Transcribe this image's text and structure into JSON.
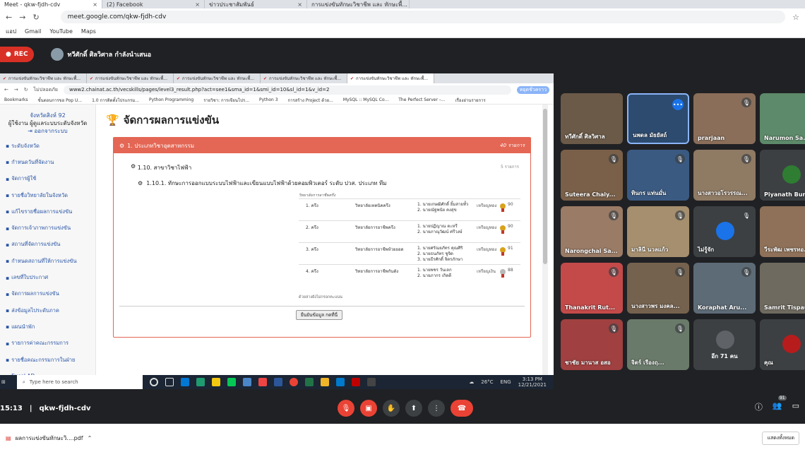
{
  "browser": {
    "tabs": [
      {
        "label": "Meet - qkw-fjdh-cdv",
        "active": true
      },
      {
        "label": "(2) Facebook",
        "active": false
      },
      {
        "label": "ข่าวประชาสัมพันธ์",
        "active": false
      },
      {
        "label": "การแข่งขันทักษะวิชาชีพ และ ทักษะพื้...",
        "active": false
      }
    ],
    "url": "meet.google.com/qkw-fjdh-cdv",
    "bookmarks": [
      "แอป",
      "Gmail",
      "YouTube",
      "Maps"
    ]
  },
  "meet": {
    "rec_label": "REC",
    "presenter": "ทวีศักดิ์ ศิลวิศาล กำลังนำเสนอ",
    "meeting_time": "15:13",
    "meeting_code": "qkw-fjdh-cdv",
    "participant_count": "91"
  },
  "shared": {
    "tabs": [
      "การแข่งขันทักษะวิชาชีพ และ ทักษะพื้...",
      "การแข่งขันทักษะวิชาชีพ และ ทักษะพื้...",
      "การแข่งขันทักษะวิชาชีพ และ ทักษะพื้...",
      "การแข่งขันทักษะวิชาชีพ และ ทักษะพื้...",
      "การแข่งขันทักษะวิชาชีพ และ ทักษะพื้..."
    ],
    "secure_label": "ไม่ปลอดภัย",
    "url": "www2.chainat.ac.th/vecskills/pages/level3_result.php?act=see1&sma_id=1&smi_id=10&sl_id=1&v_id=2",
    "profile": "หยุดชั่วคราว",
    "bookmarks": [
      "Bookmarks",
      "ขั้นตอนการขอ Pop U...",
      "1.0 การติดตั้งโปรแกรม...",
      "Python Programming",
      "รายวิชา: การเขียนโปร...",
      "Python 3",
      "การสร้าง Project ด้วย...",
      "MySQL :: MySQL Co...",
      "The Perfect Server –...",
      "เรื่องอ่านรายการ"
    ],
    "sidebar": {
      "province": "จังหวัดสิงห์ 92",
      "role": "ผู้ใช้งาน ผู้ดูแลระบบระดับจังหวัด",
      "logout": "ออกจากระบบ",
      "items": [
        "ระดับจังหวัด",
        "กำหนดวันที่จัดงาน",
        "จัดการผู้ใช้",
        "รายชื่อวิทยาลัยในจังหวัด",
        "แก้ไขรายชื่อผลการแข่งขัน",
        "จัดการเจ้าภาพการแข่งขัน",
        "สถานที่จัดการแข่งขัน",
        "กำหนดสถานที่ให้การแข่งขัน",
        "เลขที่ใบประกาศ",
        "จัดการผลการแข่งขัน",
        "ส่งข้อมูลไประดับภาค",
        "แผนนำพัก",
        "รายการค่าคณะกรรมการ",
        "รายชื่อคณะกรรมการในฝ่าย",
        "Excel AD"
      ]
    },
    "page_title": "จัดการผลการแข่งขัน",
    "category": {
      "title": "1. ประเภทวิชาอุตสาหกรรม",
      "count": "40 รายการ"
    },
    "subcategory": {
      "title": "1.10. สาขาวิชาไฟฟ้า",
      "count": "5 รายการ"
    },
    "contest": "1.10.1. ทักษะการออกแบบระบบไฟฟ้าและเขียนแบบไฟฟ้าด้วยคอมพิวเตอร์ ระดับ ปวส. ประเภท ทีม",
    "table_caption": "วิทยาลัยการอาชีพครึง",
    "results": [
      {
        "rank": "1. ครึง",
        "college": "วิทยาลัยเทคนิคครึง",
        "members": [
          "1. นายเกษฒิศักดิ์ ยิ้มสายทั้ว",
          "2. นายณัฐพนัย คงสุข"
        ],
        "medal": "เหรียญทอง",
        "medal_type": "gold",
        "score": "90"
      },
      {
        "rank": "2. ครึง",
        "college": "วิทยาลัยการอาชีพครึง",
        "members": [
          "1. นายปฏิญาณ ตะหรี",
          "2. นายภาณุวัฒน์ ศรีวงษ์"
        ],
        "medal": "เหรียญทอง",
        "medal_type": "gold",
        "score": "90"
      },
      {
        "rank": "3. ครึง",
        "college": "วิทยาลัยการอาชีพห้วยยอด",
        "members": [
          "1. นายศรัณยภัทร คุณศิริ",
          "2. นายธนภัทร ชูจิด",
          "3. นายธีรศักดิ์ จิตรภักษา"
        ],
        "medal": "เหรียญทอง",
        "medal_type": "gold",
        "score": "91"
      },
      {
        "rank": "4. ครึง",
        "college": "วิทยาลัยการอาชีพกันตัง",
        "members": [
          "1. นายพชร วันเลก",
          "2. นายภากร เกิดดี"
        ],
        "medal": "เหรียญเงิน",
        "medal_type": "silver",
        "score": "88"
      }
    ],
    "table_footer": "ด้วยล่างยังไม่กรอกคะแนน",
    "confirm_button": "ยืนยันข้อมูล กดที่นี่",
    "taskbar": {
      "search": "Type here to search",
      "weather": "26°C",
      "lang": "ENG",
      "time": "3:13 PM",
      "date": "12/21/2021"
    }
  },
  "tiles": [
    {
      "name": "ทวีศักดิ์ ศิลวิศาล",
      "bg": "#6b5a48",
      "muted": false,
      "active": false
    },
    {
      "name": "นพดล มัธยัสถ์",
      "bg": "#2d4b6f",
      "muted": false,
      "active": true,
      "more": true
    },
    {
      "name": "prarjaan",
      "bg": "#8a6e5a",
      "muted": true,
      "active": false
    },
    {
      "name": "Narumon Sa...",
      "bg": "#5d8a6a",
      "muted": true,
      "active": false
    },
    {
      "name": "Suteera Chaiy...",
      "bg": "#7a6048",
      "muted": true,
      "active": false
    },
    {
      "name": "ทินกร แท่นมั่น",
      "bg": "#3a5a82",
      "muted": true,
      "active": false
    },
    {
      "name": "นางสาวอโรวรรณ...",
      "bg": "#8f7a64",
      "muted": true,
      "active": false
    },
    {
      "name": "Piyanath Bura...",
      "bg": "#3c4043",
      "muted": true,
      "active": false,
      "avatar": "#2e7d32"
    },
    {
      "name": "Narongchai Sa...",
      "bg": "#9a7b66",
      "muted": true,
      "active": false
    },
    {
      "name": "มาลินี นวลแก้ว",
      "bg": "#a58f6e",
      "muted": true,
      "active": false
    },
    {
      "name": "ไม่รู้จัก",
      "bg": "#3c4043",
      "muted": true,
      "active": false,
      "avatar": "#1a73e8"
    },
    {
      "name": "วีระพัฒ เพชรทอ...",
      "bg": "#8e7158",
      "muted": true,
      "active": false
    },
    {
      "name": "Thanakrit Rut...",
      "bg": "#c44a4a",
      "muted": true,
      "active": false
    },
    {
      "name": "นางสาวพร มงคล...",
      "bg": "#75624e",
      "muted": true,
      "active": false
    },
    {
      "name": "Koraphat Aru...",
      "bg": "#5d6b77",
      "muted": true,
      "active": false
    },
    {
      "name": "Samrit Tispau...",
      "bg": "#6f6a5f",
      "muted": true,
      "active": false
    },
    {
      "name": "ชาชัย มานาส อสอ",
      "bg": "#a04040",
      "muted": true,
      "active": false
    },
    {
      "name": "จิตร์ เรืองฤ...",
      "bg": "#6a7a6a",
      "muted": true,
      "active": false
    },
    {
      "name": "อีก 71 คน",
      "bg": "#3c4043",
      "muted": false,
      "active": false,
      "others": true
    },
    {
      "name": "คุณ",
      "bg": "#3c4043",
      "muted": true,
      "active": false,
      "avatar": "#b71c1c"
    }
  ],
  "download": {
    "file": "ผลการแข่งขันทักษะวิ....pdf",
    "show_all": "แสดงทั้งหมด"
  }
}
